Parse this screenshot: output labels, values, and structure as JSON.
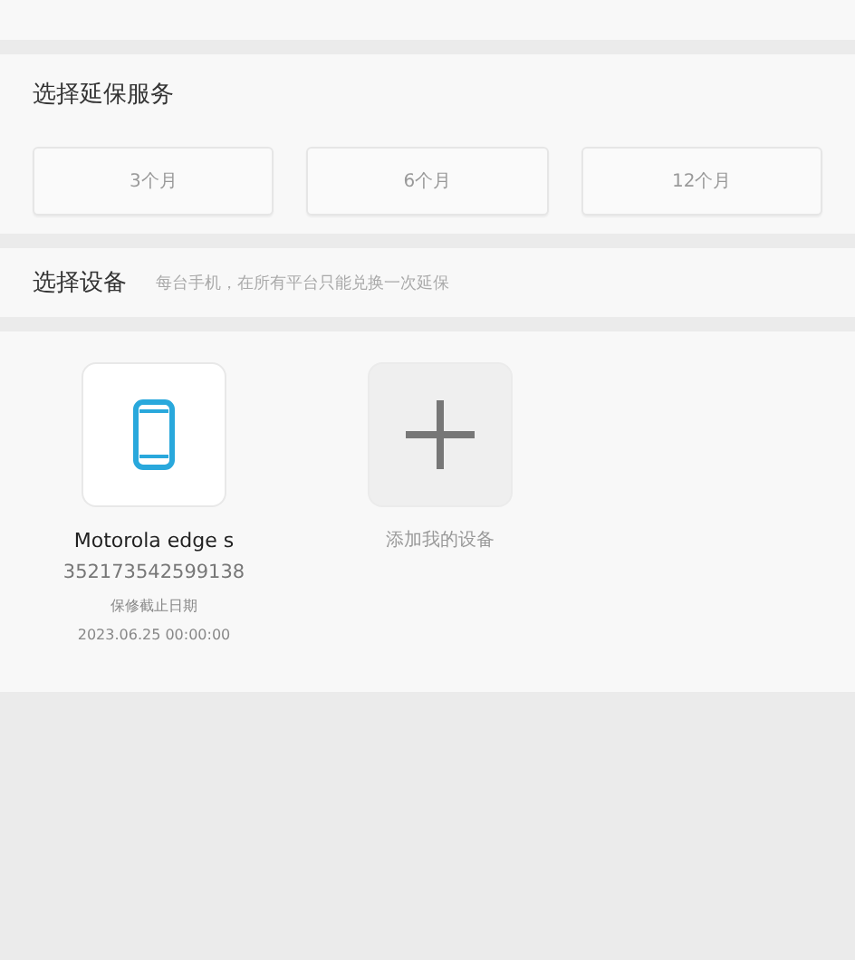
{
  "service": {
    "title": "选择延保服务",
    "options": [
      {
        "label": "3个月",
        "selected": false
      },
      {
        "label": "6个月",
        "selected": false
      },
      {
        "label": "12个月",
        "selected": false
      }
    ]
  },
  "devices": {
    "title": "选择设备",
    "hint": "每台手机，在所有平台只能兑换一次延保",
    "items": [
      {
        "kind": "device",
        "name": "Motorola edge s",
        "imei": "352173542599138",
        "expiry_label": "保修截止日期",
        "expiry": "2023.06.25 00:00:00"
      },
      {
        "kind": "add",
        "label": "添加我的设备"
      }
    ]
  }
}
